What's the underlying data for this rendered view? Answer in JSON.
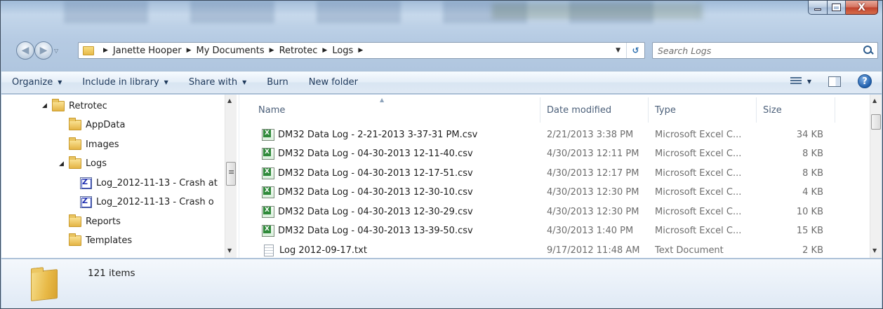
{
  "window": {
    "caption": {
      "minimize": "—",
      "maximize": "□",
      "close": "X"
    }
  },
  "address": {
    "crumbs": [
      "Janette Hooper",
      "My Documents",
      "Retrotec",
      "Logs"
    ],
    "search_placeholder": "Search Logs"
  },
  "toolbar": {
    "organize": "Organize",
    "include_in_library": "Include in library",
    "share_with": "Share with",
    "burn": "Burn",
    "new_folder": "New folder"
  },
  "nav_tree": [
    {
      "label": "Retrotec",
      "icon": "folder-icon",
      "expanded": true,
      "depth": 0
    },
    {
      "label": "AppData",
      "icon": "folder-icon",
      "depth": 1
    },
    {
      "label": "Images",
      "icon": "folder-icon",
      "depth": 1
    },
    {
      "label": "Logs",
      "icon": "folder-icon",
      "expanded": true,
      "depth": 1
    },
    {
      "label": "Log_2012-11-13 - Crash at",
      "icon": "log-icon",
      "depth": 2
    },
    {
      "label": "Log_2012-11-13 - Crash o",
      "icon": "log-icon",
      "depth": 2
    },
    {
      "label": "Reports",
      "icon": "folder-icon",
      "depth": 1
    },
    {
      "label": "Templates",
      "icon": "folder-icon",
      "depth": 1
    }
  ],
  "columns": {
    "name": "Name",
    "date": "Date modified",
    "type": "Type",
    "size": "Size"
  },
  "files": [
    {
      "name": "DM32 Data Log - 2-21-2013 3-37-31 PM.csv",
      "date": "2/21/2013 3:38 PM",
      "type": "Microsoft Excel C...",
      "size": "34 KB",
      "icon": "csv-icon"
    },
    {
      "name": "DM32 Data Log - 04-30-2013 12-11-40.csv",
      "date": "4/30/2013 12:11 PM",
      "type": "Microsoft Excel C...",
      "size": "8 KB",
      "icon": "csv-icon"
    },
    {
      "name": "DM32 Data Log - 04-30-2013 12-17-51.csv",
      "date": "4/30/2013 12:17 PM",
      "type": "Microsoft Excel C...",
      "size": "8 KB",
      "icon": "csv-icon"
    },
    {
      "name": "DM32 Data Log - 04-30-2013 12-30-10.csv",
      "date": "4/30/2013 12:30 PM",
      "type": "Microsoft Excel C...",
      "size": "4 KB",
      "icon": "csv-icon"
    },
    {
      "name": "DM32 Data Log - 04-30-2013 12-30-29.csv",
      "date": "4/30/2013 12:30 PM",
      "type": "Microsoft Excel C...",
      "size": "10 KB",
      "icon": "csv-icon"
    },
    {
      "name": "DM32 Data Log - 04-30-2013 13-39-50.csv",
      "date": "4/30/2013 1:40 PM",
      "type": "Microsoft Excel C...",
      "size": "15 KB",
      "icon": "csv-icon"
    },
    {
      "name": "Log 2012-09-17.txt",
      "date": "9/17/2012 11:48 AM",
      "type": "Text Document",
      "size": "2 KB",
      "icon": "txt-icon"
    }
  ],
  "details": {
    "item_count": "121 items"
  }
}
